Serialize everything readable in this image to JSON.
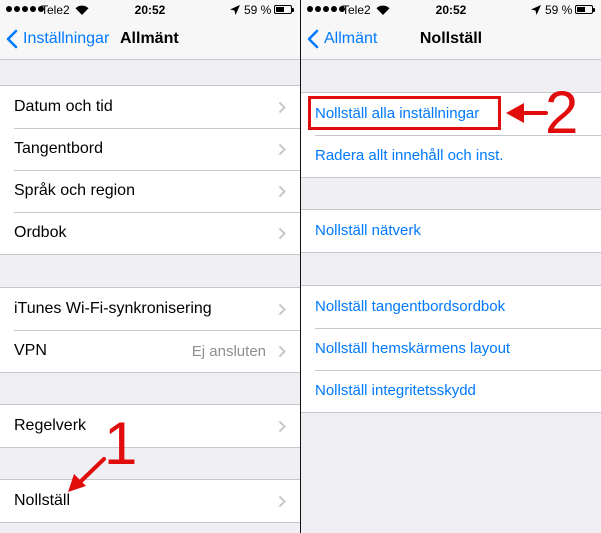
{
  "status": {
    "carrier": "Tele2",
    "time": "20:52",
    "battery": "59 %",
    "battery_level": 0.59
  },
  "left": {
    "nav": {
      "back_label": "Inställningar",
      "title": "Allmänt"
    },
    "groups": [
      [
        "Datum och tid",
        "Tangentbord",
        "Språk och region",
        "Ordbok"
      ],
      [
        "iTunes Wi-Fi-synkronisering",
        "VPN"
      ],
      [
        "Regelverk"
      ],
      [
        "Nollställ"
      ]
    ],
    "vpn_value": "Ej ansluten",
    "annotation": "1"
  },
  "right": {
    "nav": {
      "back_label": "Allmänt",
      "title": "Nollställ"
    },
    "groups": [
      [
        "Nollställ alla inställningar",
        "Radera allt innehåll och inst."
      ],
      [
        "Nollställ nätverk"
      ],
      [
        "Nollställ tangentbordsordbok",
        "Nollställ hemskärmens layout",
        "Nollställ integritetsskydd"
      ]
    ],
    "annotation": "2"
  },
  "colors": {
    "accent": "#007aff",
    "annotation": "#e10d0d",
    "background": "#efeff4"
  },
  "icons": {
    "back": "chevron-left-icon",
    "row": "chevron-right-icon",
    "location": "location-arrow-icon",
    "wifi": "wifi-icon",
    "battery": "battery-icon"
  }
}
